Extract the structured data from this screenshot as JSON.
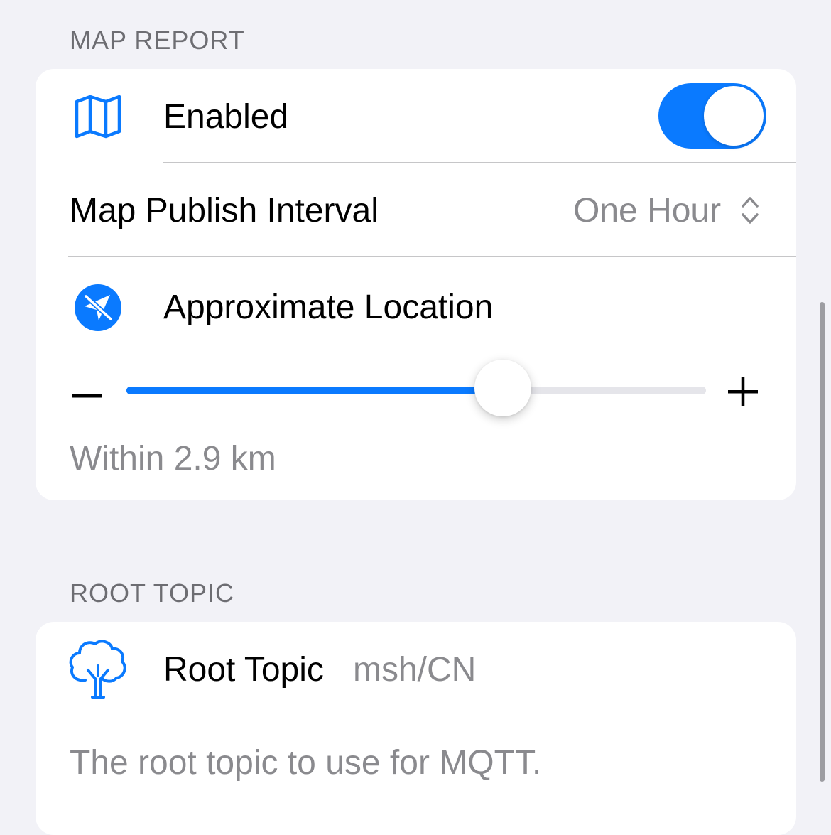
{
  "map_report": {
    "header": "MAP REPORT",
    "enabled_label": "Enabled",
    "enabled_icon": "map-icon",
    "enabled_on": true,
    "publish_interval_label": "Map Publish Interval",
    "publish_interval_value": "One Hour",
    "approx_location_label": "Approximate Location",
    "approx_location_icon": "location-arrow-icon",
    "slider_fraction": 0.65,
    "slider_min_symbol": "−",
    "slider_max_symbol": "+",
    "precision_text": "Within 2.9 km"
  },
  "root_topic": {
    "header": "ROOT TOPIC",
    "label": "Root Topic",
    "value": "msh/CN",
    "icon": "tree-icon",
    "footer": "The root topic to use for MQTT."
  },
  "colors": {
    "accent": "#0a7aff",
    "background": "#f2f2f7",
    "card": "#ffffff",
    "secondary_text": "#8a8a8e",
    "header_text": "#6d6d72"
  }
}
